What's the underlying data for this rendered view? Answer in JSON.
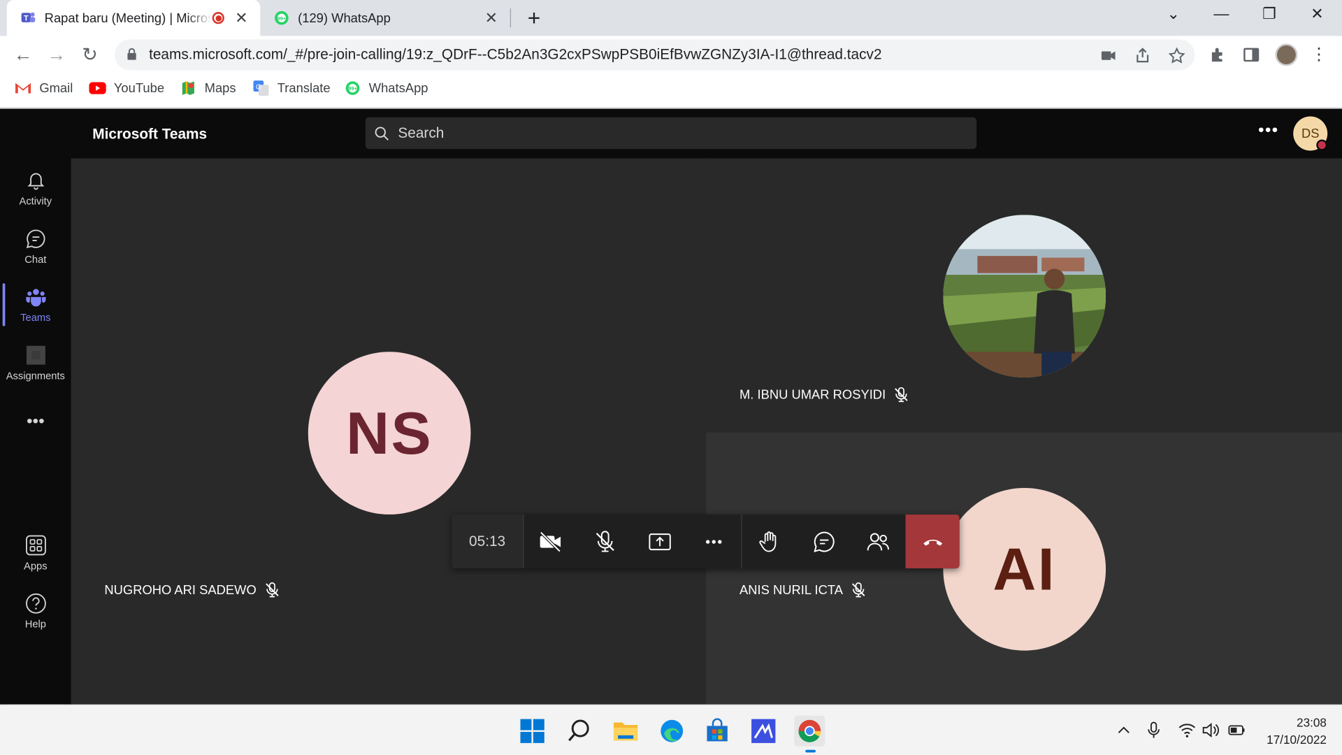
{
  "browser": {
    "tabs": [
      {
        "title": "Rapat baru (Meeting) | Microsoft Teams",
        "active": true,
        "recording": true
      },
      {
        "title": "(129) WhatsApp",
        "active": false
      }
    ],
    "url": "teams.microsoft.com/_#/pre-join-calling/19:z_QDrF--C5b2An3G2cxPSwpPSB0iEfBvwZGNZy3IA-I1@thread.tacv2",
    "bookmarks": [
      "Gmail",
      "YouTube",
      "Maps",
      "Translate",
      "WhatsApp"
    ]
  },
  "teams": {
    "brand": "Microsoft Teams",
    "search_placeholder": "Search",
    "user_initials": "DS",
    "rail": [
      {
        "label": "Activity",
        "icon": "bell-icon"
      },
      {
        "label": "Chat",
        "icon": "chat-icon"
      },
      {
        "label": "Teams",
        "icon": "teams-icon",
        "active": true
      },
      {
        "label": "Assignments",
        "icon": "assignments-icon"
      },
      {
        "label": "Apps",
        "icon": "apps-icon"
      },
      {
        "label": "Help",
        "icon": "help-icon"
      }
    ],
    "participants": [
      {
        "initials": "NS",
        "name": "NUGROHO ARI SADEWO",
        "muted": true
      },
      {
        "initials": "",
        "name": "M. IBNU UMAR ROSYIDI",
        "muted": true,
        "has_photo": true
      },
      {
        "initials": "AI",
        "name": "ANIS NURIL ICTA",
        "muted": true
      }
    ],
    "call": {
      "timer": "05:13"
    }
  },
  "taskbar": {
    "time": "23:08",
    "date": "17/10/2022"
  },
  "colors": {
    "teams_accent": "#7f85f5",
    "hangup": "#a4373a",
    "avatar_ns_bg": "#f4d4d5",
    "avatar_ns_fg": "#6b2530",
    "avatar_ai_bg": "#f2d6cc",
    "avatar_ai_fg": "#5c1f12"
  }
}
